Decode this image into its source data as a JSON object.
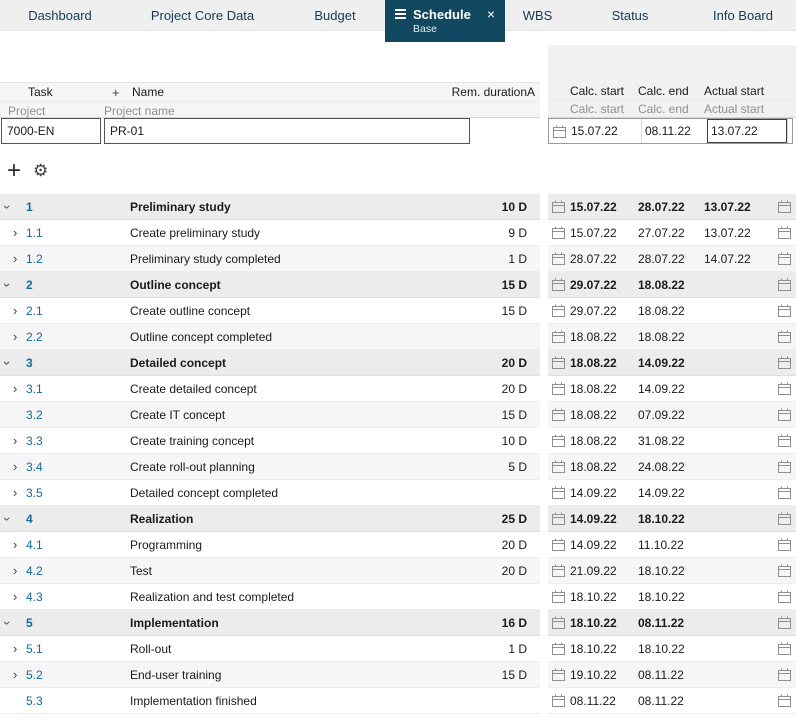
{
  "tabs": {
    "items": [
      {
        "label": "Dashboard",
        "active": false
      },
      {
        "label": "Project Core Data",
        "active": false
      },
      {
        "label": "Budget",
        "active": false
      },
      {
        "label": "Schedule",
        "active": true,
        "sublabel": "Base",
        "close": "×"
      },
      {
        "label": "WBS",
        "active": false
      },
      {
        "label": "Status",
        "active": false
      },
      {
        "label": "Info Board",
        "active": false
      }
    ]
  },
  "grid": {
    "header": {
      "task": "Task",
      "plus": "+",
      "name": "Name",
      "rem_duration": "Rem. duration",
      "a": "A",
      "calc_start": "Calc. start",
      "calc_end": "Calc. end",
      "actual_start": "Actual start"
    },
    "subheader": {
      "project": "Project",
      "project_name": "Project name",
      "calc_start": "Calc. start",
      "calc_end": "Calc. end",
      "actual_start": "Actual start"
    },
    "project": {
      "id": "7000-EN",
      "name": "PR-01",
      "calc_start": "15.07.22",
      "calc_end": "08.11.22",
      "actual_start": "13.07.22"
    }
  },
  "toolbar": {
    "add_label": "+",
    "settings_glyph": "⚙"
  },
  "colors": {
    "active_tab": "#12485f",
    "task_number_blue": "#156a9c",
    "group_row_bg": "#ececec"
  },
  "tasks": [
    {
      "num": "1",
      "name": "Preliminary study",
      "duration": "10 D",
      "calc_start": "15.07.22",
      "calc_end": "28.07.22",
      "actual_start": "13.07.22",
      "group": true,
      "chevron": "v"
    },
    {
      "num": "1.1",
      "name": "Create preliminary study",
      "duration": "9 D",
      "calc_start": "15.07.22",
      "calc_end": "27.07.22",
      "actual_start": "13.07.22",
      "group": false,
      "chevron": ">"
    },
    {
      "num": "1.2",
      "name": "Preliminary study completed",
      "duration": "1 D",
      "calc_start": "28.07.22",
      "calc_end": "28.07.22",
      "actual_start": "14.07.22",
      "group": false,
      "chevron": ">"
    },
    {
      "num": "2",
      "name": "Outline concept",
      "duration": "15 D",
      "calc_start": "29.07.22",
      "calc_end": "18.08.22",
      "actual_start": "",
      "group": true,
      "chevron": "v"
    },
    {
      "num": "2.1",
      "name": "Create outline concept",
      "duration": "15 D",
      "calc_start": "29.07.22",
      "calc_end": "18.08.22",
      "actual_start": "",
      "group": false,
      "chevron": ">"
    },
    {
      "num": "2.2",
      "name": "Outline concept completed",
      "duration": "",
      "calc_start": "18.08.22",
      "calc_end": "18.08.22",
      "actual_start": "",
      "group": false,
      "chevron": ">"
    },
    {
      "num": "3",
      "name": "Detailed concept",
      "duration": "20 D",
      "calc_start": "18.08.22",
      "calc_end": "14.09.22",
      "actual_start": "",
      "group": true,
      "chevron": "v"
    },
    {
      "num": "3.1",
      "name": "Create detailed concept",
      "duration": "20 D",
      "calc_start": "18.08.22",
      "calc_end": "14.09.22",
      "actual_start": "",
      "group": false,
      "chevron": ">"
    },
    {
      "num": "3.2",
      "name": "Create IT concept",
      "duration": "15 D",
      "calc_start": "18.08.22",
      "calc_end": "07.09.22",
      "actual_start": "",
      "group": false,
      "chevron": ""
    },
    {
      "num": "3.3",
      "name": "Create training concept",
      "duration": "10 D",
      "calc_start": "18.08.22",
      "calc_end": "31.08.22",
      "actual_start": "",
      "group": false,
      "chevron": ">"
    },
    {
      "num": "3.4",
      "name": "Create roll-out planning",
      "duration": "5 D",
      "calc_start": "18.08.22",
      "calc_end": "24.08.22",
      "actual_start": "",
      "group": false,
      "chevron": ">"
    },
    {
      "num": "3.5",
      "name": "Detailed concept completed",
      "duration": "",
      "calc_start": "14.09.22",
      "calc_end": "14.09.22",
      "actual_start": "",
      "group": false,
      "chevron": ">"
    },
    {
      "num": "4",
      "name": "Realization",
      "duration": "25 D",
      "calc_start": "14.09.22",
      "calc_end": "18.10.22",
      "actual_start": "",
      "group": true,
      "chevron": "v"
    },
    {
      "num": "4.1",
      "name": "Programming",
      "duration": "20 D",
      "calc_start": "14.09.22",
      "calc_end": "11.10.22",
      "actual_start": "",
      "group": false,
      "chevron": ">"
    },
    {
      "num": "4.2",
      "name": "Test",
      "duration": "20 D",
      "calc_start": "21.09.22",
      "calc_end": "18.10.22",
      "actual_start": "",
      "group": false,
      "chevron": ">"
    },
    {
      "num": "4.3",
      "name": "Realization and test completed",
      "duration": "",
      "calc_start": "18.10.22",
      "calc_end": "18.10.22",
      "actual_start": "",
      "group": false,
      "chevron": ">"
    },
    {
      "num": "5",
      "name": "Implementation",
      "duration": "16 D",
      "calc_start": "18.10.22",
      "calc_end": "08.11.22",
      "actual_start": "",
      "group": true,
      "chevron": "v"
    },
    {
      "num": "5.1",
      "name": "Roll-out",
      "duration": "1 D",
      "calc_start": "18.10.22",
      "calc_end": "18.10.22",
      "actual_start": "",
      "group": false,
      "chevron": ">"
    },
    {
      "num": "5.2",
      "name": "End-user training",
      "duration": "15 D",
      "calc_start": "19.10.22",
      "calc_end": "08.11.22",
      "actual_start": "",
      "group": false,
      "chevron": ">"
    },
    {
      "num": "5.3",
      "name": "Implementation finished",
      "duration": "",
      "calc_start": "08.11.22",
      "calc_end": "08.11.22",
      "actual_start": "",
      "group": false,
      "chevron": ""
    }
  ]
}
